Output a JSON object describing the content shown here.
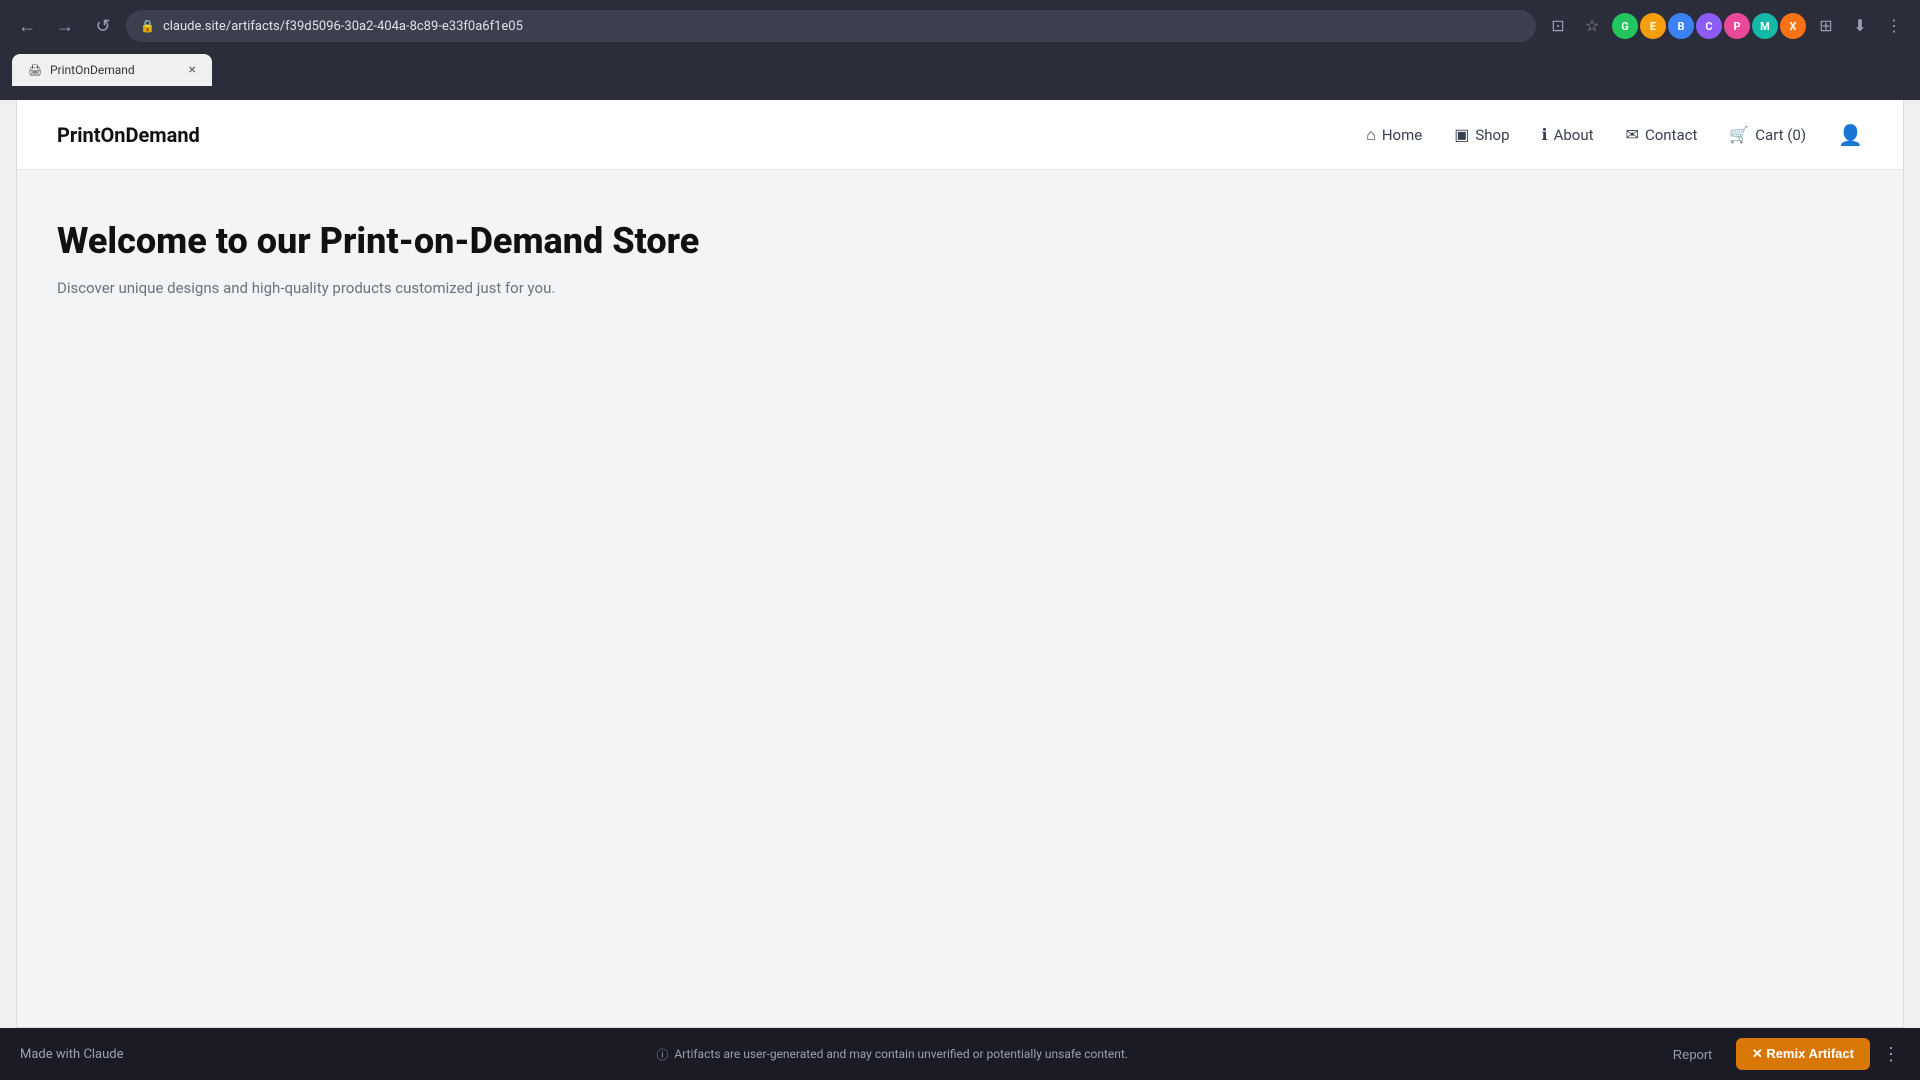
{
  "browser": {
    "url": "claude.site/artifacts/f39d5096-30a2-404a-8c89-e33f0a6f1e05",
    "tab_title": "PrintOnDemand",
    "back_label": "←",
    "forward_label": "→",
    "reload_label": "↺"
  },
  "site": {
    "logo": "PrintOnDemand",
    "nav": {
      "home_label": "Home",
      "shop_label": "Shop",
      "about_label": "About",
      "contact_label": "Contact",
      "cart_label": "Cart (0)"
    },
    "hero": {
      "title": "Welcome to our Print-on-Demand Store",
      "subtitle": "Discover unique designs and high-quality products customized just for you."
    }
  },
  "footer": {
    "made_with": "Made with Claude",
    "disclaimer": "Artifacts are user-generated and may contain unverified or potentially unsafe content.",
    "report_label": "Report",
    "remix_label": "✕ Remix Artifact"
  }
}
